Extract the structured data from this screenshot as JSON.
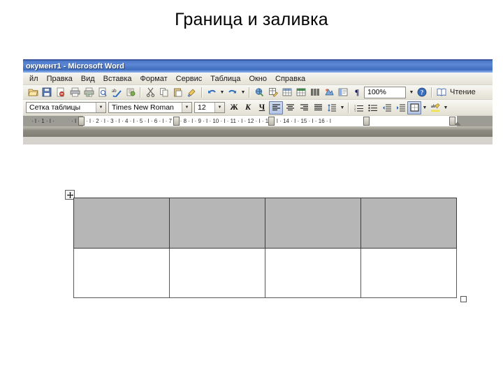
{
  "slide": {
    "title": "Граница и заливка"
  },
  "word": {
    "titlebar": {
      "text": "окумент1 - Microsoft Word"
    },
    "menu": [
      {
        "label": "йл",
        "accel": ""
      },
      {
        "label": "Правка",
        "accel": "П"
      },
      {
        "label": "Вид",
        "accel": "В"
      },
      {
        "label": "Вставка",
        "accel": "а"
      },
      {
        "label": "Формат",
        "accel": "м"
      },
      {
        "label": "Сервис",
        "accel": "р"
      },
      {
        "label": "Таблица",
        "accel": "Т"
      },
      {
        "label": "Окно",
        "accel": "О"
      },
      {
        "label": "Справка",
        "accel": "С"
      }
    ],
    "standard_toolbar": {
      "buttons": [
        "open-icon",
        "save-icon",
        "permission-icon",
        "print-icon",
        "print-preview-icon",
        "search-icon",
        "spelling-icon",
        "research-icon",
        "cut-icon",
        "copy-icon",
        "paste-icon",
        "format-painter-icon",
        "undo-icon",
        "redo-icon",
        "hyperlink-icon",
        "tables-borders-icon",
        "insert-table-icon",
        "insert-excel-icon",
        "columns-icon",
        "drawing-icon",
        "document-map-icon",
        "show-marks-icon"
      ],
      "zoom_value": "100%",
      "help_icon": "help-icon",
      "reading_label": "Чтение",
      "reading_accel": "Ч"
    },
    "formatting_toolbar": {
      "style_value": "Сетка таблицы",
      "font_value": "Times New Roman",
      "size_value": "12",
      "bold_label": "Ж",
      "italic_label": "К",
      "underline_label": "Ч",
      "align_icons": [
        "align-left-icon",
        "align-center-icon",
        "align-right-icon",
        "align-justify-icon"
      ],
      "active_align": "align-left-icon",
      "line_spacing_icon": "line-spacing-icon",
      "numbering_icon": "numbering-icon",
      "bullets_icon": "bullets-icon",
      "decrease_indent_icon": "decrease-indent-icon",
      "increase_indent_icon": "increase-indent-icon",
      "borders_icon": "borders-icon",
      "highlight_icon": "highlight-color-icon"
    },
    "ruler": {
      "left_numbers": [
        "1"
      ],
      "numbers": [
        "1",
        "2",
        "3",
        "4",
        "5",
        "6",
        "7",
        "8",
        "9",
        "10",
        "11",
        "12",
        "13",
        "14",
        "15",
        "16"
      ]
    }
  },
  "document": {
    "table": {
      "move_handle_icon": "table-move-handle-icon",
      "resize_handle_icon": "table-resize-handle-icon",
      "columns": 4,
      "rows": [
        {
          "type": "header",
          "fill": "#b6b6b6",
          "cells": [
            "",
            "",
            "",
            ""
          ]
        },
        {
          "type": "body",
          "fill": "#ffffff",
          "cells": [
            "",
            "",
            "",
            ""
          ]
        }
      ]
    }
  },
  "colors": {
    "header_fill": "#b6b6b6",
    "body_fill": "#ffffff",
    "border": "#3d3d3d",
    "titlebar_blue": "#3f6cbd",
    "toolbar_bg": "#ece9df"
  }
}
